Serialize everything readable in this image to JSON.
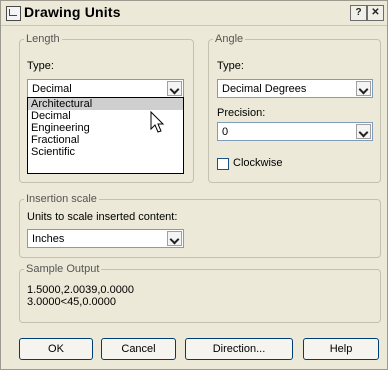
{
  "window": {
    "title": "Drawing Units",
    "help_glyph": "?",
    "close_glyph": "✕"
  },
  "length": {
    "legend": "Length",
    "type_label": "Type:",
    "type_value": "Decimal",
    "dropdown_options": [
      "Architectural",
      "Decimal",
      "Engineering",
      "Fractional",
      "Scientific"
    ],
    "highlighted_option": "Architectural"
  },
  "angle": {
    "legend": "Angle",
    "type_label": "Type:",
    "type_value": "Decimal Degrees",
    "precision_label": "Precision:",
    "precision_value": "0",
    "clockwise_label": "Clockwise",
    "clockwise_checked": false
  },
  "insertion": {
    "legend": "Insertion scale",
    "units_label": "Units to scale inserted content:",
    "units_value": "Inches"
  },
  "sample": {
    "legend": "Sample Output",
    "line1": "1.5000,2.0039,0.0000",
    "line2": "3.0000<45,0.0000"
  },
  "buttons": {
    "ok": "OK",
    "cancel": "Cancel",
    "direction": "Direction...",
    "help": "Help"
  },
  "icons": [
    "app-icon",
    "help-icon",
    "close-icon",
    "chevron-down-icon",
    "mouse-pointer-icon"
  ]
}
